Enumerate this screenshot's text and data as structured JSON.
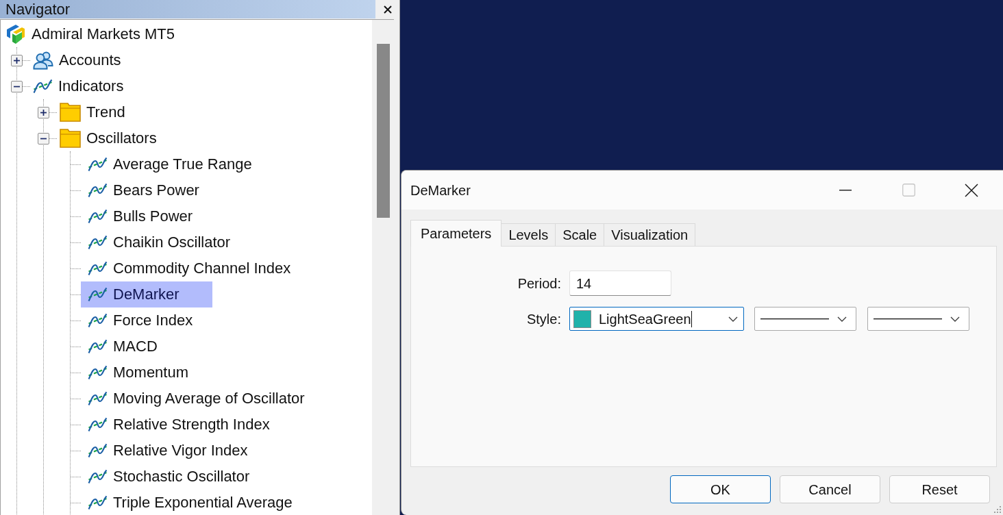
{
  "navigator": {
    "title": "Navigator",
    "tree": [
      {
        "label": "Admiral Markets MT5",
        "kind": "terminal",
        "selected": false,
        "children": [
          {
            "label": "Accounts",
            "kind": "accounts",
            "expanded": false,
            "selected": false
          },
          {
            "label": "Indicators",
            "kind": "indicators",
            "expanded": true,
            "selected": false,
            "children": [
              {
                "label": "Trend",
                "kind": "folder",
                "expanded": false,
                "selected": false
              },
              {
                "label": "Oscillators",
                "kind": "folder",
                "expanded": true,
                "selected": false,
                "children": [
                  {
                    "label": "Average True Range",
                    "kind": "indicator",
                    "selected": false
                  },
                  {
                    "label": "Bears Power",
                    "kind": "indicator",
                    "selected": false
                  },
                  {
                    "label": "Bulls Power",
                    "kind": "indicator",
                    "selected": false
                  },
                  {
                    "label": "Chaikin Oscillator",
                    "kind": "indicator",
                    "selected": false
                  },
                  {
                    "label": "Commodity Channel Index",
                    "kind": "indicator",
                    "selected": false
                  },
                  {
                    "label": "DeMarker",
                    "kind": "indicator",
                    "selected": true
                  },
                  {
                    "label": "Force Index",
                    "kind": "indicator",
                    "selected": false
                  },
                  {
                    "label": "MACD",
                    "kind": "indicator",
                    "selected": false
                  },
                  {
                    "label": "Momentum",
                    "kind": "indicator",
                    "selected": false
                  },
                  {
                    "label": "Moving Average of Oscillator",
                    "kind": "indicator",
                    "selected": false
                  },
                  {
                    "label": "Relative Strength Index",
                    "kind": "indicator",
                    "selected": false
                  },
                  {
                    "label": "Relative Vigor Index",
                    "kind": "indicator",
                    "selected": false
                  },
                  {
                    "label": "Stochastic Oscillator",
                    "kind": "indicator",
                    "selected": false
                  },
                  {
                    "label": "Triple Exponential Average",
                    "kind": "indicator",
                    "selected": false
                  }
                ]
              }
            ]
          }
        ]
      }
    ]
  },
  "dialog": {
    "title": "DeMarker",
    "maximize_disabled": true,
    "tabs": [
      {
        "label": "Parameters",
        "selected": true
      },
      {
        "label": "Levels",
        "selected": false
      },
      {
        "label": "Scale",
        "selected": false
      },
      {
        "label": "Visualization",
        "selected": false
      }
    ],
    "fields": [
      {
        "kind": "number",
        "label": "Period:",
        "value": "14"
      },
      {
        "kind": "style",
        "label": "Style:",
        "color_name": "LightSeaGreen",
        "color": "#20b2aa",
        "focused": true
      }
    ],
    "buttons": [
      {
        "label": "OK",
        "default": true
      },
      {
        "label": "Cancel",
        "default": false
      },
      {
        "label": "Reset",
        "default": false
      }
    ]
  }
}
